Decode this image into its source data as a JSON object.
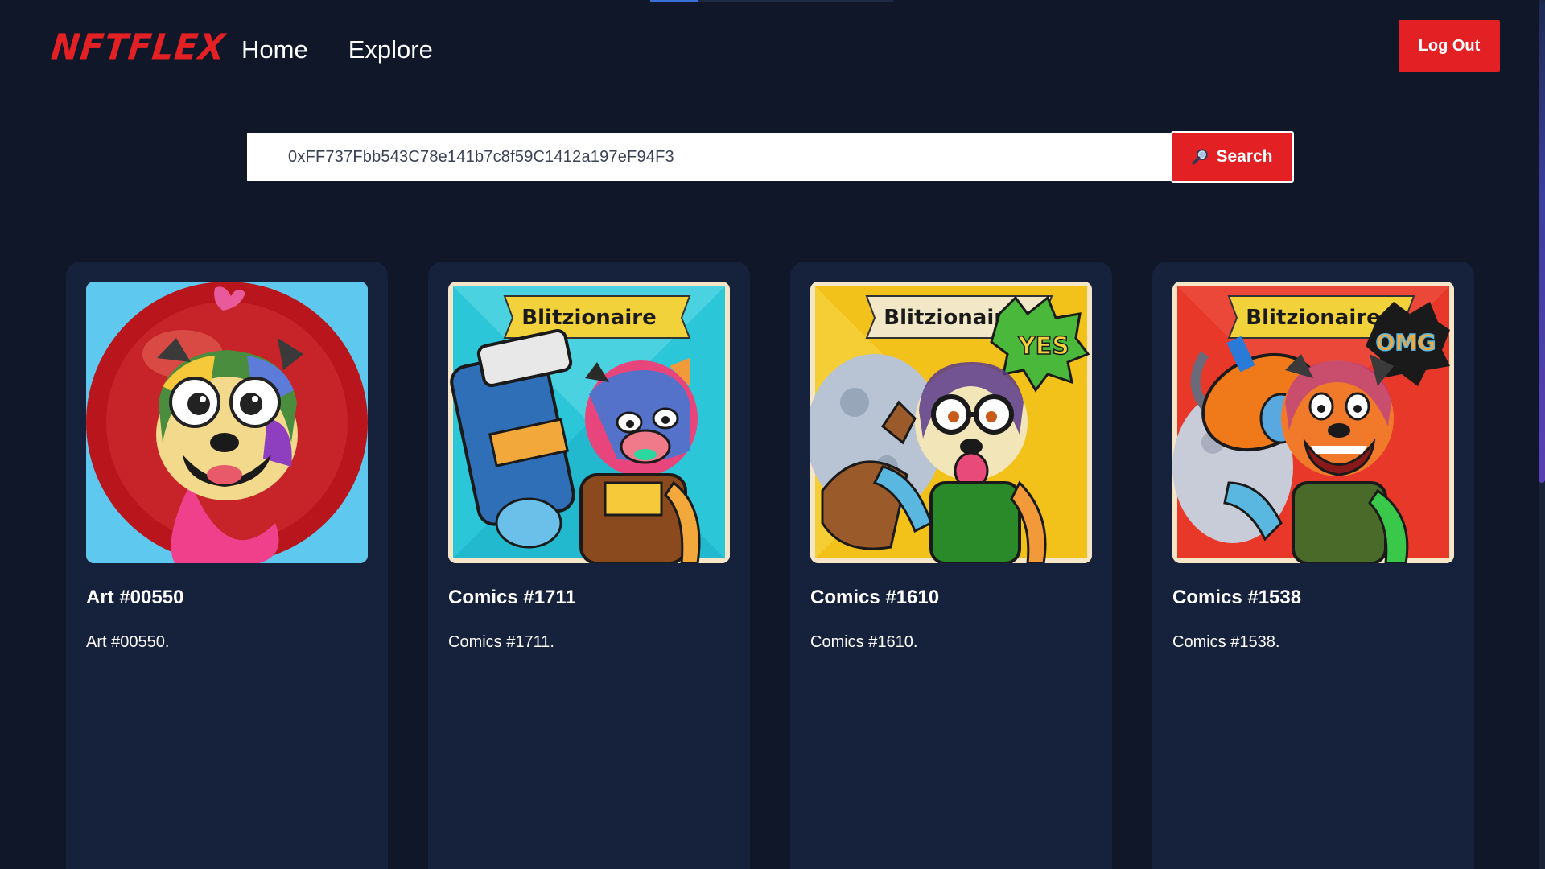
{
  "header": {
    "logo": "NFTFLEX",
    "nav": [
      "Home",
      "Explore"
    ],
    "logout_label": "Log Out"
  },
  "search": {
    "value": "0xFF737Fbb543C78e141b7c8f59C1412a197eF94F3",
    "button_label": "Search"
  },
  "cards": [
    {
      "title": "Art #00550",
      "description": "Art #00550."
    },
    {
      "title": "Comics #1711",
      "description": "Comics #1711."
    },
    {
      "title": "Comics #1610",
      "description": "Comics #1610."
    },
    {
      "title": "Comics #1538",
      "description": "Comics #1538."
    }
  ],
  "artwork": {
    "banner_text": "Blitzionaire",
    "bubble_yes": "YES",
    "bubble_omg": "OMG"
  },
  "colors": {
    "background": "#0f1729",
    "card": "#16213b",
    "accent": "#e32124",
    "text": "#ffffff"
  },
  "icons": {
    "search": "magnifier-icon"
  }
}
